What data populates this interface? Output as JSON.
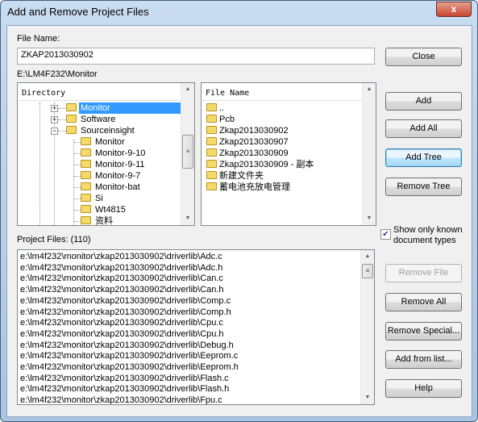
{
  "window": {
    "title": "Add and Remove Project Files",
    "close_glyph": "x"
  },
  "file_name": {
    "label": "File Name:",
    "value": "ZKAP2013030902"
  },
  "current_path": "E:\\LM4F232\\Monitor",
  "directory": {
    "header": "Directory",
    "items": [
      {
        "label": "Monitor",
        "expander": "+",
        "selected": true,
        "level": 1
      },
      {
        "label": "Software",
        "expander": "+",
        "level": 1
      },
      {
        "label": "Sourceinsight",
        "expander": "-",
        "level": 1
      },
      {
        "label": "Monitor",
        "level": 2
      },
      {
        "label": "Monitor-9-10",
        "level": 2
      },
      {
        "label": "Monitor-9-11",
        "level": 2
      },
      {
        "label": "Monitor-9-7",
        "level": 2
      },
      {
        "label": "Monitor-bat",
        "level": 2
      },
      {
        "label": "Si",
        "level": 2
      },
      {
        "label": "Wt4815",
        "level": 2
      },
      {
        "label": "资料",
        "level": 2
      }
    ]
  },
  "files": {
    "header": "File Name",
    "items": [
      "..",
      "Pcb",
      "Zkap2013030902",
      "Zkap2013030907",
      "Zkap2013030909",
      "Zkap2013030909 - 副本",
      "新建文件夹",
      "蓄电池充放电管理"
    ]
  },
  "buttons": {
    "close": "Close",
    "add": "Add",
    "add_all": "Add All",
    "add_tree": "Add Tree",
    "remove_tree": "Remove Tree",
    "remove_file": "Remove File",
    "remove_all": "Remove All",
    "remove_special": "Remove Special...",
    "add_from_list": "Add from list...",
    "help": "Help"
  },
  "show_known": {
    "label_line1": "Show only known",
    "label_line2": "document types",
    "checked": true
  },
  "project_files": {
    "label": "Project Files: (110)",
    "items": [
      "e:\\lm4f232\\monitor\\zkap2013030902\\driverlib\\Adc.c",
      "e:\\lm4f232\\monitor\\zkap2013030902\\driverlib\\Adc.h",
      "e:\\lm4f232\\monitor\\zkap2013030902\\driverlib\\Can.c",
      "e:\\lm4f232\\monitor\\zkap2013030902\\driverlib\\Can.h",
      "e:\\lm4f232\\monitor\\zkap2013030902\\driverlib\\Comp.c",
      "e:\\lm4f232\\monitor\\zkap2013030902\\driverlib\\Comp.h",
      "e:\\lm4f232\\monitor\\zkap2013030902\\driverlib\\Cpu.c",
      "e:\\lm4f232\\monitor\\zkap2013030902\\driverlib\\Cpu.h",
      "e:\\lm4f232\\monitor\\zkap2013030902\\driverlib\\Debug.h",
      "e:\\lm4f232\\monitor\\zkap2013030902\\driverlib\\Eeprom.c",
      "e:\\lm4f232\\monitor\\zkap2013030902\\driverlib\\Eeprom.h",
      "e:\\lm4f232\\monitor\\zkap2013030902\\driverlib\\Flash.c",
      "e:\\lm4f232\\monitor\\zkap2013030902\\driverlib\\Flash.h",
      "e:\\lm4f232\\monitor\\zkap2013030902\\driverlib\\Fpu.c"
    ]
  }
}
